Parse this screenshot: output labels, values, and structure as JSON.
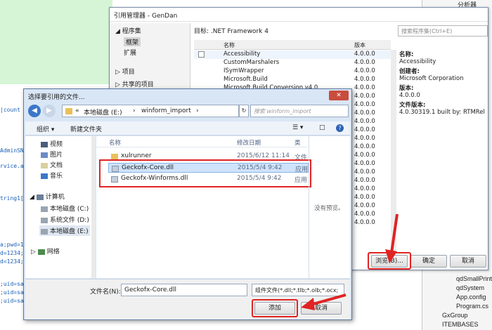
{
  "editor": {
    "lines": [
      "|count",
      "AdminSN",
      "rvice.a",
      "tring1[",
      "a;pwd=1",
      "d=1234;",
      "d=1234;",
      ";uid=sa",
      ";uid=sa",
      ";uid=sa"
    ]
  },
  "solution": {
    "header": "分析器",
    "items": [
      "qdSmallPrint",
      "qdSystem",
      "App.config",
      "Program.cs",
      "GxGroup",
      "ITEMBASES"
    ]
  },
  "reference_manager": {
    "title": "引用管理器 - GenDan",
    "nav": {
      "assemblies": "程序集",
      "framework": "框架",
      "extensions": "扩展",
      "project": "项目",
      "shared_project": "共享的项目"
    },
    "target": "目标: .NET Framework 4",
    "search_placeholder": "搜索程序集(Ctrl+E)",
    "columns": {
      "name": "名称",
      "version": "版本"
    },
    "assemblies": [
      {
        "name": "Accessibility",
        "version": "4.0.0.0"
      },
      {
        "name": "CustomMarshalers",
        "version": "4.0.0.0"
      },
      {
        "name": "ISymWrapper",
        "version": "4.0.0.0"
      },
      {
        "name": "Microsoft.Build",
        "version": "4.0.0.0"
      },
      {
        "name": "Microsoft.Build.Conversion.v4.0",
        "version": "4.0.0.0"
      }
    ],
    "extra_versions": [
      "4.0.0.0",
      "4.0.0.0",
      "4.0.0.0",
      "4.0.0.0",
      "4.0.0.0",
      "4.0.0.0",
      "4.0.0.0",
      "4.0.0.0",
      "4.0.0.0",
      "4.0.0.0",
      "4.0.0.0",
      "4.0.0.0",
      "4.0.0.0",
      "4.0.0.0",
      "4.0.0.0",
      "4.0.0.0"
    ],
    "details": {
      "name_label": "名称:",
      "name_value": "Accessibility",
      "creator_label": "创建者:",
      "creator_value": "Microsoft Corporation",
      "version_label": "版本:",
      "version_value": "4.0.0.0",
      "file_version_label": "文件版本:",
      "file_version_value": "4.0.30319.1 built by: RTMRel"
    },
    "buttons": {
      "browse": "浏览(B)...",
      "ok": "确定",
      "cancel": "取消"
    }
  },
  "file_dialog": {
    "title": "选择要引用的文件...",
    "close": "✕",
    "breadcrumb": [
      "«",
      "本地磁盘 (E:)",
      "›",
      "winform_import",
      "›"
    ],
    "search_placeholder": "搜索 winform_import",
    "toolbar": {
      "organize": "组织 ▾",
      "new_folder": "新建文件夹"
    },
    "nav": [
      {
        "label": "视频",
        "icon": "video-icon"
      },
      {
        "label": "图片",
        "icon": "picture-icon"
      },
      {
        "label": "文档",
        "icon": "document-icon"
      },
      {
        "label": "音乐",
        "icon": "music-icon"
      },
      {
        "label": "计算机",
        "icon": "computer-icon"
      },
      {
        "label": "本地磁盘 (C:)",
        "icon": "drive-icon"
      },
      {
        "label": "系统文件 (D:)",
        "icon": "drive-icon"
      },
      {
        "label": "本地磁盘 (E:)",
        "icon": "drive-icon"
      },
      {
        "label": "网络",
        "icon": "network-icon"
      }
    ],
    "columns": {
      "name": "名称",
      "date": "修改日期",
      "type": "类"
    },
    "files": [
      {
        "name": "xulrunner",
        "date": "2015/6/12 11:14",
        "type": "文件",
        "icon": "folder-icon"
      },
      {
        "name": "Geckofx-Core.dll",
        "date": "2015/5/4 9:42",
        "type": "应用",
        "icon": "dll-icon"
      },
      {
        "name": "Geckofx-Winforms.dll",
        "date": "2015/5/4 9:42",
        "type": "应用",
        "icon": "dll-icon"
      }
    ],
    "no_preview": "没有预览。",
    "filename_label": "文件名(N):",
    "filename_value": "Geckofx-Core.dll",
    "filetype_value": "组件文件(*.dll;*.tlb;*.olb;*.ocx;",
    "buttons": {
      "add": "添加",
      "cancel": "取消"
    }
  },
  "colors": {
    "highlight": "#e02323",
    "selection": "#cfe3fb",
    "dialog_frame": "#d9e6f5"
  }
}
